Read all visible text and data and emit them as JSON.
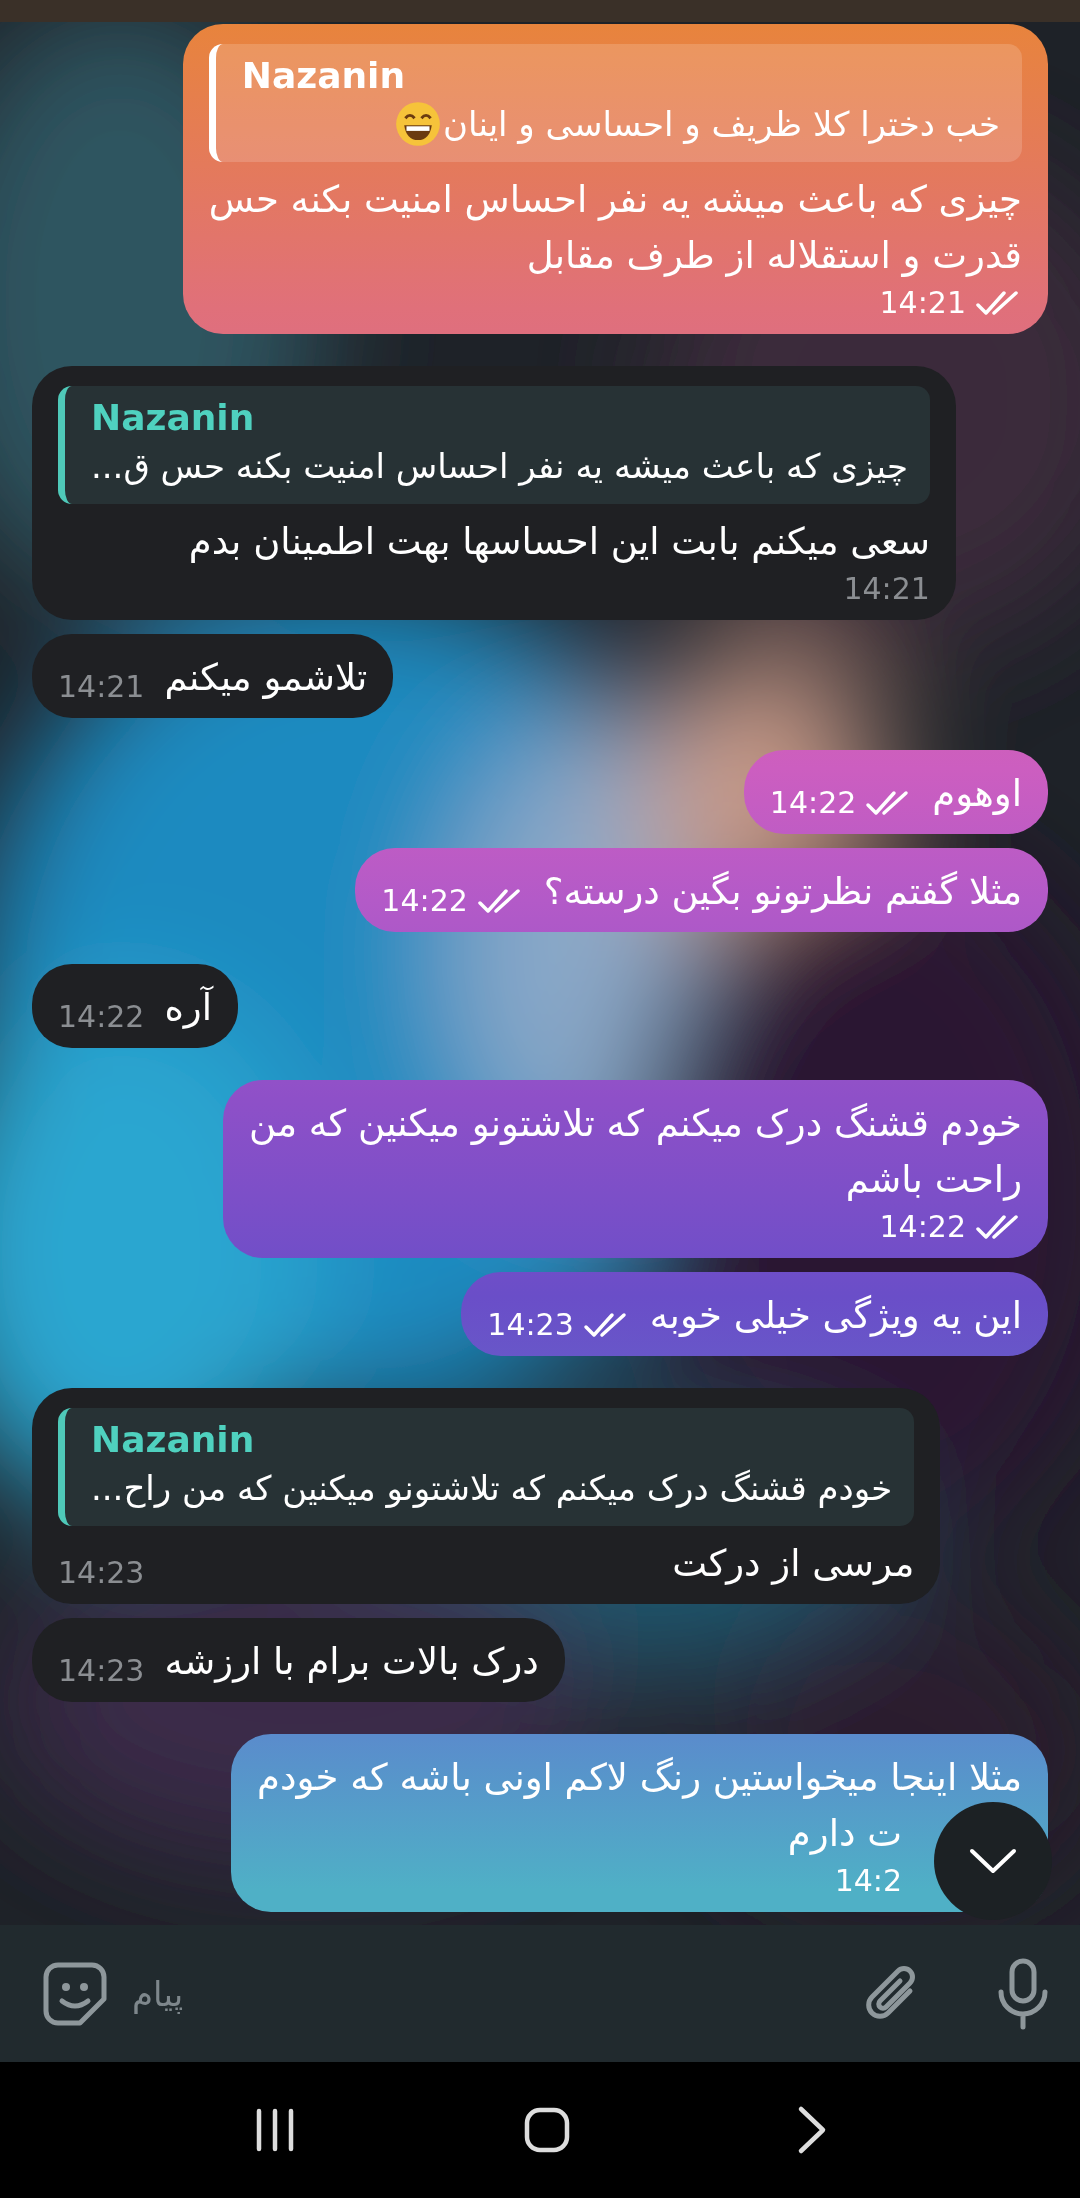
{
  "messages": [
    {
      "kind": "outgoing",
      "reply": {
        "name": "Nazanin",
        "text": "خب دخترا کلا ظریف و احساسی و اینان",
        "emoji": true
      },
      "lines": [
        "چیزی که باعث میشه یه نفر احساس امنیت بکنه حس",
        "قدرت و استقلاله از طرف مقابل"
      ],
      "time": "14:21",
      "read": true
    },
    {
      "kind": "incoming",
      "reply": {
        "name": "Nazanin",
        "text": "چیزی که باعث میشه یه نفر احساس امنیت بکنه حس ق..."
      },
      "lines": [
        "سعی میکنم بابت این احساسها بهت اطمینان بدم"
      ],
      "time": "14:21",
      "read": false
    },
    {
      "kind": "incoming",
      "lines": [
        "تلاشمو میکنم"
      ],
      "time": "14:21",
      "read": false
    },
    {
      "kind": "outgoing",
      "lines": [
        "اوهوم"
      ],
      "time": "14:22",
      "read": true
    },
    {
      "kind": "outgoing",
      "lines": [
        "مثلا گفتم نظرتونو بگین درسته؟"
      ],
      "time": "14:22",
      "read": true
    },
    {
      "kind": "incoming",
      "lines": [
        "آره"
      ],
      "time": "14:22",
      "read": false
    },
    {
      "kind": "outgoing",
      "lines": [
        "خودم قشنگ درک میکنم که تلاشتونو میکنین که من",
        "راحت باشم"
      ],
      "time": "14:22",
      "read": true
    },
    {
      "kind": "outgoing",
      "lines": [
        "این یه ویژگی خیلی خوبه"
      ],
      "time": "14:23",
      "read": true
    },
    {
      "kind": "incoming",
      "reply": {
        "name": "Nazanin",
        "text": "خودم قشنگ درک میکنم که تلاشتونو میکنین که من راح..."
      },
      "lines": [
        "مرسی از درکت"
      ],
      "time": "14:23",
      "read": false
    },
    {
      "kind": "incoming",
      "lines": [
        "درک بالات برام با ارزشه"
      ],
      "time": "14:23",
      "read": false
    },
    {
      "kind": "outgoing",
      "lines": [
        "مثلا اینجا میخواستین رنگ لاکم اونی باشه که خودم",
        "ت دارم"
      ],
      "time": "14:2",
      "read": false,
      "obscured": true
    }
  ],
  "composer": {
    "placeholder": "پیام"
  }
}
